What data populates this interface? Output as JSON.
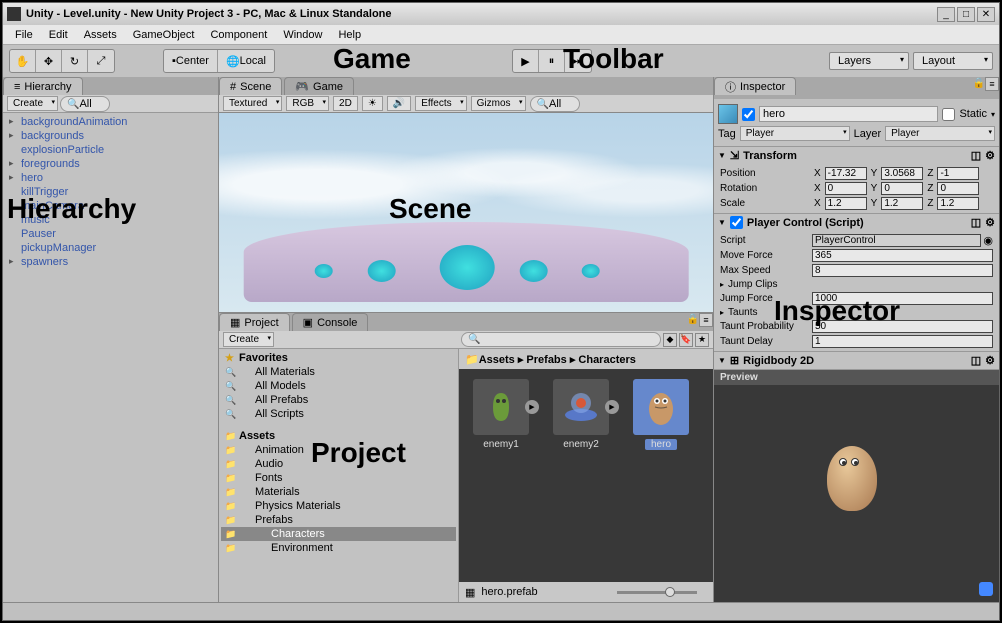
{
  "window": {
    "title": "Unity - Level.unity - New Unity Project 3 - PC, Mac & Linux Standalone"
  },
  "menu": [
    "File",
    "Edit",
    "Assets",
    "GameObject",
    "Component",
    "Window",
    "Help"
  ],
  "toolbar": {
    "center": "Center",
    "local": "Local",
    "layers": "Layers",
    "layout": "Layout"
  },
  "hierarchy": {
    "tab": "Hierarchy",
    "create": "Create",
    "search_placeholder": "All",
    "items": [
      {
        "label": "backgroundAnimation",
        "expand": true
      },
      {
        "label": "backgrounds",
        "expand": true
      },
      {
        "label": "explosionParticle",
        "expand": false
      },
      {
        "label": "foregrounds",
        "expand": true
      },
      {
        "label": "hero",
        "expand": true
      },
      {
        "label": "killTrigger",
        "expand": false
      },
      {
        "label": "mainCamera",
        "expand": false
      },
      {
        "label": "music",
        "expand": false
      },
      {
        "label": "Pauser",
        "expand": false
      },
      {
        "label": "pickupManager",
        "expand": false
      },
      {
        "label": "spawners",
        "expand": true
      }
    ]
  },
  "scene": {
    "scene_tab": "Scene",
    "game_tab": "Game",
    "shaded": "Textured",
    "rgb": "RGB",
    "twoD": "2D",
    "effects": "Effects",
    "gizmos": "Gizmos",
    "search_placeholder": "All"
  },
  "project": {
    "project_tab": "Project",
    "console_tab": "Console",
    "create": "Create",
    "favorites": "Favorites",
    "fav_items": [
      "All Materials",
      "All Models",
      "All Prefabs",
      "All Scripts"
    ],
    "assets": "Assets",
    "asset_folders": [
      "Animation",
      "Audio",
      "Fonts",
      "Materials",
      "Physics Materials",
      "Prefabs"
    ],
    "prefab_sub": [
      "Characters",
      "Environment"
    ],
    "breadcrumb": "Assets ▸ Prefabs ▸ Characters",
    "items": [
      {
        "name": "enemy1"
      },
      {
        "name": "enemy2"
      },
      {
        "name": "hero"
      }
    ],
    "status_item": "hero.prefab"
  },
  "inspector": {
    "tab": "Inspector",
    "object_name": "hero",
    "static_label": "Static",
    "tag_label": "Tag",
    "tag_value": "Player",
    "layer_label": "Layer",
    "layer_value": "Player",
    "transform": {
      "title": "Transform",
      "position": "Position",
      "rotation": "Rotation",
      "scale": "Scale",
      "px": "-17.32",
      "py": "3.0568",
      "pz": "-1",
      "rx": "0",
      "ry": "0",
      "rz": "0",
      "sx": "1.2",
      "sy": "1.2",
      "sz": "1.2"
    },
    "player_control": {
      "title": "Player Control (Script)",
      "script_label": "Script",
      "script_value": "PlayerControl",
      "move_force_label": "Move Force",
      "move_force": "365",
      "max_speed_label": "Max Speed",
      "max_speed": "8",
      "jump_clips_label": "Jump Clips",
      "jump_force_label": "Jump Force",
      "jump_force": "1000",
      "taunts_label": "Taunts",
      "taunt_prob_label": "Taunt Probability",
      "taunt_prob": "50",
      "taunt_delay_label": "Taunt Delay",
      "taunt_delay": "1"
    },
    "rigidbody": {
      "title": "Rigidbody 2D"
    },
    "preview_label": "Preview"
  },
  "annotations": {
    "toolbar": "Toolbar",
    "game": "Game",
    "scene": "Scene",
    "hierarchy": "Hierarchy",
    "project": "Project",
    "inspector": "Inspector"
  }
}
